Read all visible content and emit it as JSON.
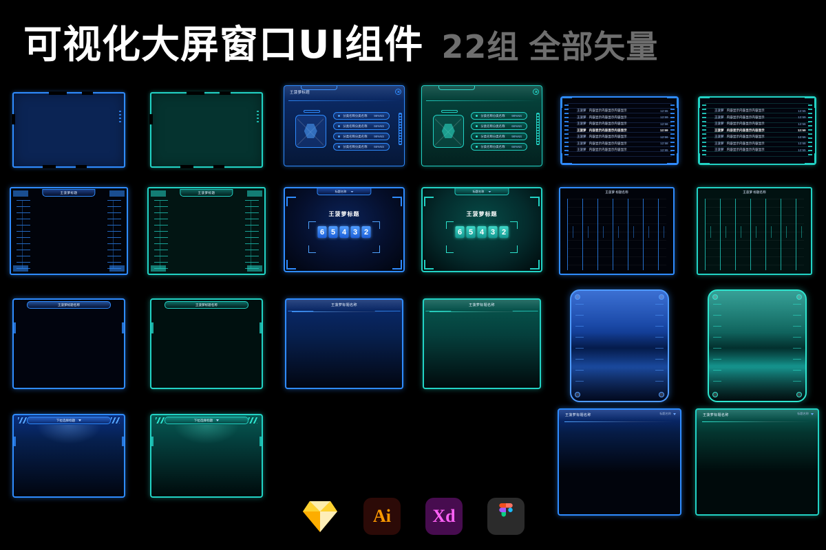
{
  "header": {
    "title_main": "可视化大屏窗口UI组件",
    "title_sub_count": "22组",
    "title_sub_note": "全部矢量"
  },
  "labels": {
    "title_short": "王菠萝标题",
    "title_long": "王菠萝标题名称",
    "title_name": "王菠萝 标题名称",
    "dropdown_label": "标题名称",
    "dropdown_label2": "下拉选择标题",
    "dropdown_small": "下拉选择"
  },
  "list_card": {
    "title": "王菠萝标题",
    "rows": [
      {
        "label": "分类名称分类名称",
        "value": "98%NS"
      },
      {
        "label": "分类名称分类名称",
        "value": "66%NS"
      },
      {
        "label": "分类名称分类名称",
        "value": "98%NS"
      },
      {
        "label": "分类名称分类名称",
        "value": "66%NS"
      }
    ]
  },
  "text_card": {
    "lines": [
      {
        "name": "王菠萝",
        "content": "内容显示内容显示内容显示",
        "time": "12:55"
      },
      {
        "name": "王菠萝",
        "content": "内容显示内容显示内容显示",
        "time": "12:59"
      },
      {
        "name": "王菠萝",
        "content": "内容显示内容显示内容显示",
        "time": "12:56"
      },
      {
        "name": "王菠萝",
        "content": "内容显示内容显示内容显示",
        "time": "12:59"
      },
      {
        "name": "王菠萝",
        "content": "内容显示内容显示内容显示",
        "time": "12:56"
      },
      {
        "name": "王菠萝",
        "content": "内容显示内容显示内容显示",
        "time": "12:58"
      },
      {
        "name": "王菠萝",
        "content": "内容显示内容显示内容显示",
        "time": "12:55"
      }
    ]
  },
  "number_card": {
    "title": "王菠萝标题",
    "dropdown": "标题名称",
    "digits": [
      "6",
      "5",
      "4",
      "3",
      "2"
    ]
  },
  "apps": [
    {
      "name": "sketch",
      "label": ""
    },
    {
      "name": "illustrator",
      "label": "Ai"
    },
    {
      "name": "adobe-xd",
      "label": "Xd"
    },
    {
      "name": "figma",
      "label": ""
    }
  ],
  "colors": {
    "blue_line": "#2f8cff",
    "blue_accent": "#4fa3ff",
    "teal_line": "#22d3c5",
    "teal_accent": "#2ee6cf",
    "background": "#000000",
    "title_white": "#ffffff",
    "title_gray": "#6e6e6e"
  }
}
